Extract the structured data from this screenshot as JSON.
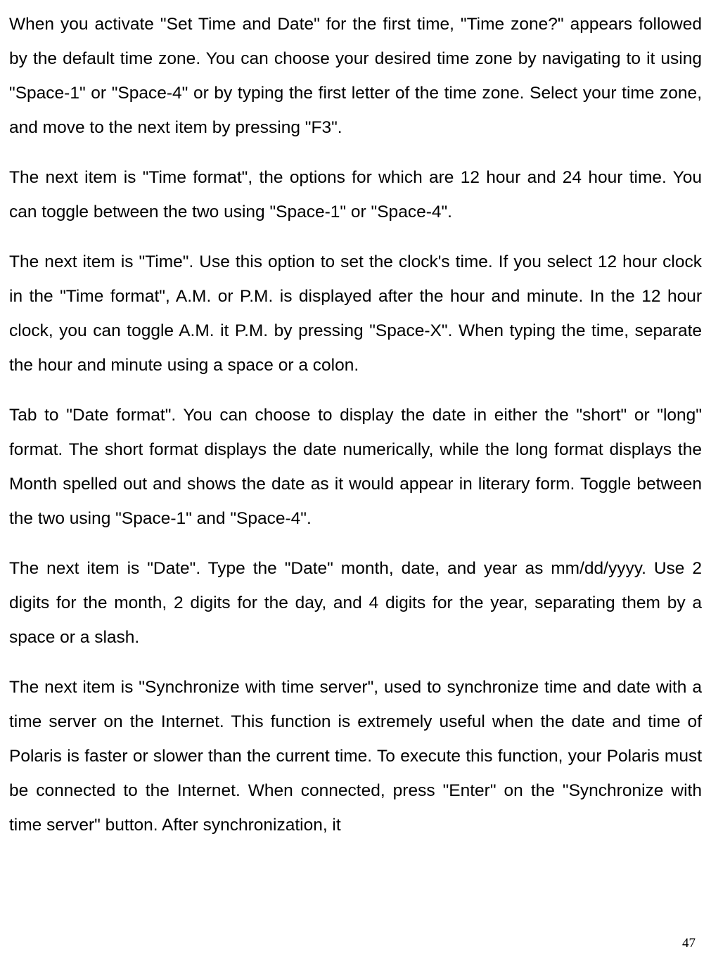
{
  "paragraphs": {
    "p1": "When you activate \"Set Time and Date\" for the first time, \"Time zone?\" appears followed by the default time zone. You can choose your desired time zone by navigating to it using \"Space-1\" or \"Space-4\" or by typing the first letter of the time zone. Select your time zone, and move to the next item by pressing \"F3\".",
    "p2": "The next item is \"Time format\", the options for which are 12 hour and 24 hour time. You can toggle between the two using \"Space-1\" or \"Space-4\".",
    "p3": "The next item is \"Time\". Use this option to set the clock's time. If you select 12 hour clock in the \"Time format\", A.M. or P.M. is displayed after the hour and minute. In the 12 hour clock, you can toggle A.M. it P.M. by pressing \"Space-X\". When typing the time, separate the hour and minute using a space or a colon.",
    "p4": "Tab to \"Date format\". You can choose to display the date in either the \"short\" or \"long\" format. The short format displays the date numerically, while the long format displays the Month spelled out and shows the date as it would appear in literary form. Toggle between the two using \"Space-1\" and \"Space-4\".",
    "p5": "The next item is \"Date\". Type the \"Date\" month, date, and year as mm/dd/yyyy. Use 2 digits for the month, 2 digits for the day, and 4 digits for the year, separating them by a space or a slash.",
    "p6": "The next item is \"Synchronize with time server\", used to synchronize time and date with a time server on the Internet. This function is extremely useful when the date and time of Polaris is faster or slower than the current time. To execute this function, your Polaris must be connected to the Internet. When connected, press \"Enter\" on the \"Synchronize with time server\" button. After synchronization, it"
  },
  "page_number": "47"
}
